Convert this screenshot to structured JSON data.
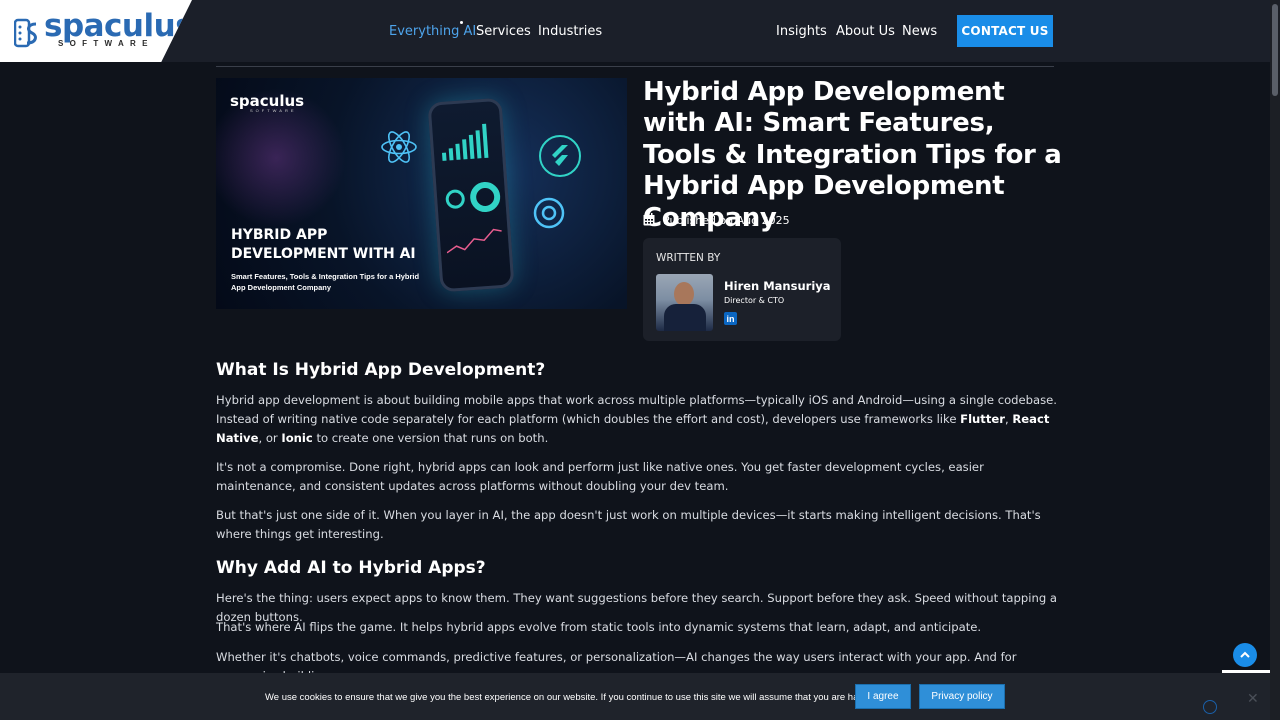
{
  "header": {
    "logo_text": "spaculus",
    "logo_sub": "SOFTWARE",
    "nav": [
      "Everything AI",
      "Services",
      "Industries",
      "Insights",
      "About Us",
      "News"
    ],
    "contact_label": "CONTACT US"
  },
  "hero": {
    "logo": "spaculus",
    "logo_sub": "SOFTWARE",
    "title": "HYBRID APP DEVELOPMENT WITH AI",
    "subtitle": "Smart Features, Tools & Integration Tips for a Hybrid App Development Company"
  },
  "article": {
    "title": "Hybrid App Development with AI: Smart Features, Tools & Integration Tips for a Hybrid App Development Company",
    "published": "Published on Aug 2025",
    "written_by": "WRITTEN BY",
    "author_name": "Hiren Mansuriya",
    "author_role": "Director & CTO",
    "h2_1": "What Is Hybrid App Development?",
    "p1_a": "Hybrid app development is about building mobile apps that work across multiple platforms—typically iOS and Android—using a single codebase. Instead of writing native code separately for each platform (which doubles the effort and cost), developers use frameworks like ",
    "p1_flutter": "Flutter",
    "p1_sep1": ", ",
    "p1_rn": "React Native",
    "p1_sep2": ", or ",
    "p1_ionic": "Ionic",
    "p1_b": " to create one version that runs on both.",
    "p2": "It's not a compromise. Done right, hybrid apps can look and perform just like native ones. You get faster development cycles, easier maintenance, and consistent updates across platforms without doubling your dev team.",
    "p3": "But that's just one side of it. When you layer in AI, the app doesn't just work on multiple devices—it starts making intelligent decisions. That's where things get interesting.",
    "h2_2": "Why Add AI to Hybrid Apps?",
    "p4": "Here's the thing: users expect apps to know them. They want suggestions before they search. Support before they ask. Speed without tapping a dozen buttons.",
    "p5": "That's where AI flips the game. It helps hybrid apps evolve from static tools into dynamic systems that learn, adapt, and anticipate.",
    "p6": "Whether it's chatbots, voice commands, predictive features, or personalization—AI changes the way users interact with your app. And for companies building"
  },
  "cookie": {
    "text": "We use cookies to ensure that we give you the best experience on our website. If you continue to use this site we will assume that you are happy with it.",
    "agree": "I agree",
    "privacy": "Privacy policy",
    "close": "✕"
  },
  "icons": {
    "calendar": "calendar-icon",
    "linkedin": "linkedin-icon",
    "to_top": "chevron-up-icon"
  },
  "colors": {
    "accent": "#1a8de8",
    "nav_active": "#4ea4ec",
    "background": "#0f131b"
  }
}
